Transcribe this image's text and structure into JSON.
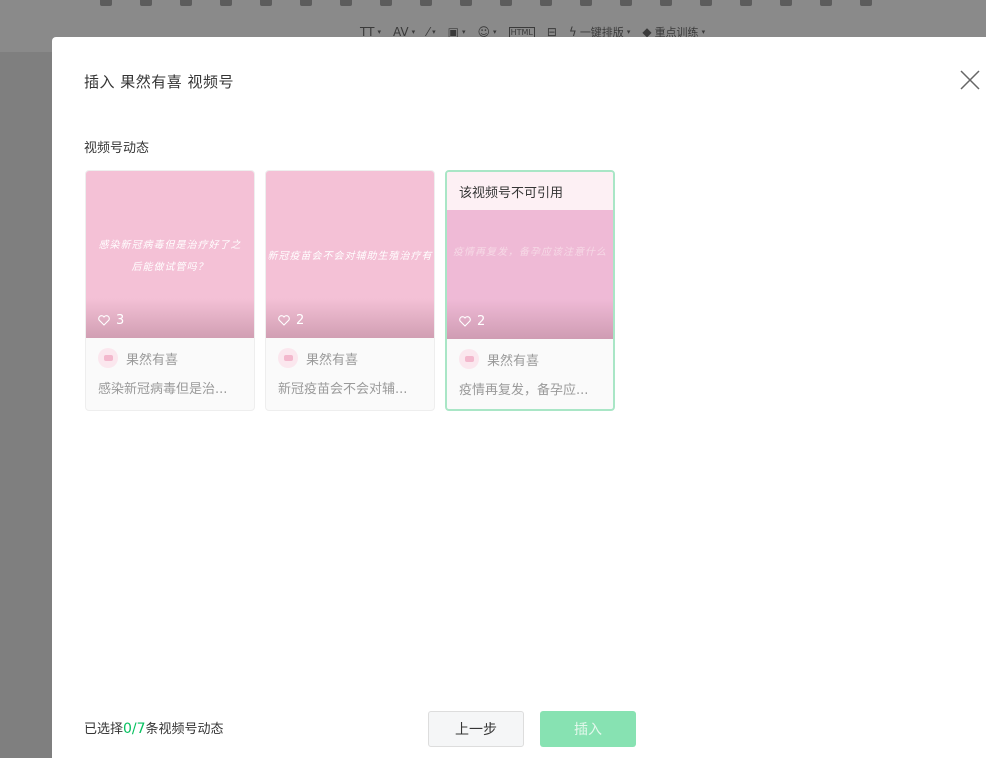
{
  "background_toolbar": {
    "tools": [
      "TT",
      "AV",
      "",
      "",
      "",
      "HTML",
      "",
      "一键排版",
      "重点训练"
    ]
  },
  "dialog": {
    "title": "插入 果然有喜 视频号",
    "section_label": "视频号动态",
    "cards": [
      {
        "cover_caption": "感染新冠病毒但是治疗好了之后能做试管吗？",
        "cover_caption_line1": "感染新冠病毒但是治疗好了之",
        "cover_caption_line2": "后能做试管吗？",
        "likes": "3",
        "author": "果然有喜",
        "description": "感染新冠病毒但是治...",
        "disabled": false
      },
      {
        "cover_caption": "新冠疫苗会不会对辅助生殖治疗有",
        "cover_caption_line1": "新冠疫苗会不会对辅助生殖治疗有",
        "likes": "2",
        "author": "果然有喜",
        "description": "新冠疫苗会不会对辅...",
        "disabled": false
      },
      {
        "notice": "该视频号不可引用",
        "cover_caption": "疫情再复发，备孕应该注意什么",
        "cover_caption_line1": "疫情再复发，备孕应该注意什么",
        "likes": "2",
        "author": "果然有喜",
        "description": "疫情再复发，备孕应...",
        "disabled": true
      }
    ],
    "footer": {
      "prefix": "已选择",
      "count": "0/7",
      "suffix": "条视频号动态"
    },
    "buttons": {
      "prev": "上一步",
      "insert": "插入"
    }
  },
  "colors": {
    "accent_green": "#07c160",
    "insert_disabled_bg": "#87e2b2",
    "disabled_card_border": "#a9e6c6",
    "cover_pink": "#f4c1d6"
  }
}
